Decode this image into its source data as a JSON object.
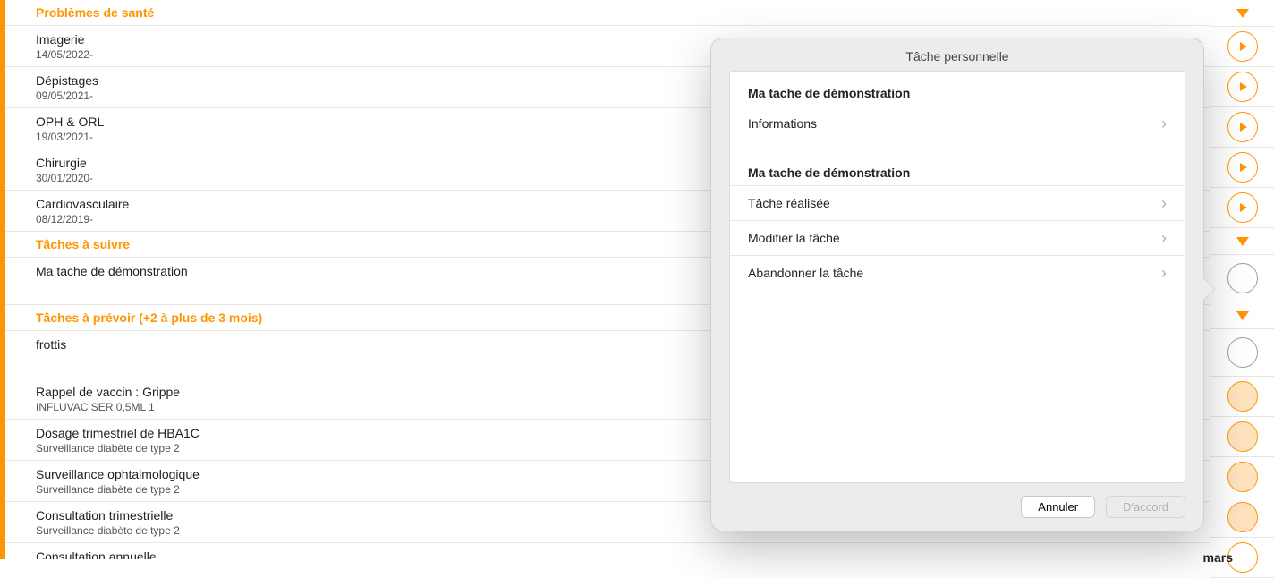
{
  "sections": {
    "problems": {
      "header": "Problèmes de santé",
      "items": [
        {
          "title": "Imagerie",
          "date": "14/05/2022-"
        },
        {
          "title": "Dépistages",
          "date": "09/05/2021-"
        },
        {
          "title": "OPH & ORL",
          "date": "19/03/2021-"
        },
        {
          "title": "Chirurgie",
          "date": "30/01/2020-"
        },
        {
          "title": "Cardiovasculaire",
          "date": "08/12/2019-"
        }
      ]
    },
    "todo": {
      "header": "Tâches à suivre",
      "items": [
        {
          "title": "Ma tache de démonstration"
        }
      ]
    },
    "planned": {
      "header": "Tâches à prévoir (+2 à plus de 3 mois)",
      "items": [
        {
          "title": "frottis"
        },
        {
          "title": "Rappel de vaccin : Grippe",
          "sub": "INFLUVAC SER 0,5ML 1"
        },
        {
          "title": "Dosage trimestriel de HBA1C",
          "sub": "Surveillance diabète de type 2"
        },
        {
          "title": "Surveillance ophtalmologique",
          "sub": "Surveillance diabète de type 2"
        },
        {
          "title": "Consultation trimestrielle",
          "sub": "Surveillance diabète de type 2"
        },
        {
          "title": "Consultation annuelle"
        }
      ]
    }
  },
  "right_col": {
    "month_label": "mars"
  },
  "popover": {
    "title": "Tâche personnelle",
    "group1": {
      "label": "Ma tache de démonstration",
      "items": [
        "Informations"
      ]
    },
    "group2": {
      "label": "Ma tache de démonstration",
      "items": [
        "Tâche réalisée",
        "Modifier la tâche",
        "Abandonner la tâche"
      ]
    },
    "cancel": "Annuler",
    "ok": "D'accord"
  }
}
